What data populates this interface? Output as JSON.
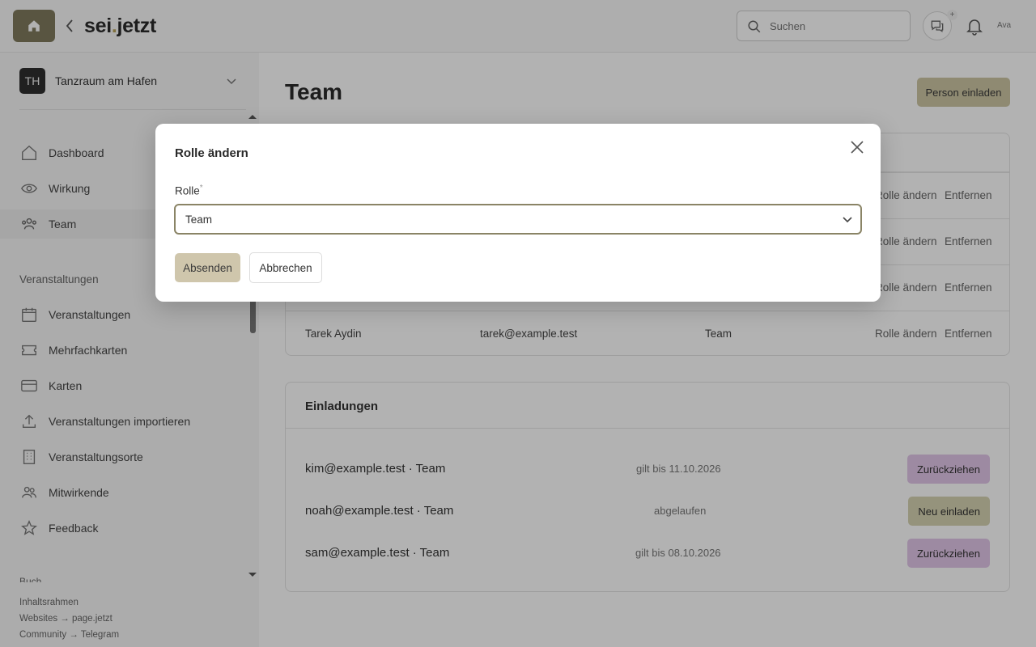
{
  "header": {
    "brand_prefix": "sei",
    "brand_dot": ".",
    "brand_suffix": "jetzt",
    "search_placeholder": "Suchen",
    "chat_plus": "+",
    "avatar_alt": "Ava"
  },
  "sidebar": {
    "org_initials": "TH",
    "org_name": "Tanzraum am Hafen",
    "items": [
      {
        "label": "Dashboard",
        "icon": "home-icon"
      },
      {
        "label": "Wirkung",
        "icon": "eye-icon"
      },
      {
        "label": "Team",
        "icon": "users-icon",
        "active": true
      }
    ],
    "section_events": "Veranstaltungen",
    "event_items": [
      {
        "label": "Veranstaltungen",
        "icon": "calendar-icon"
      },
      {
        "label": "Mehrfachkarten",
        "icon": "ticket-icon"
      },
      {
        "label": "Karten",
        "icon": "card-icon"
      },
      {
        "label": "Veranstaltungen importieren",
        "icon": "upload-icon"
      },
      {
        "label": "Veranstaltungsorte",
        "icon": "building-icon"
      },
      {
        "label": "Mitwirkende",
        "icon": "people-icon"
      },
      {
        "label": "Feedback",
        "icon": "star-icon"
      }
    ],
    "section_partial": "Buch",
    "footer": [
      "Inhaltsrahmen",
      "Websites → page.jetzt",
      "Community → Telegram"
    ]
  },
  "main": {
    "title": "Team",
    "invite_button": "Person einladen",
    "members": [
      {
        "name": "",
        "email": "",
        "role": "",
        "change": "Rolle ändern",
        "remove": "Entfernen"
      },
      {
        "name": "",
        "email": "",
        "role": "",
        "change": "Rolle ändern",
        "remove": "Entfernen"
      },
      {
        "name": "",
        "email": "",
        "role": "",
        "change": "Rolle ändern",
        "remove": "Entfernen"
      },
      {
        "name": "Tarek Aydin",
        "email": "tarek@example.test",
        "role": "Team",
        "change": "Rolle ändern",
        "remove": "Entfernen"
      }
    ],
    "invites_title": "Einladungen",
    "invites": [
      {
        "email": "kim@example.test · Team",
        "status": "gilt bis 11.10.2026",
        "action": "Zurückziehen"
      },
      {
        "email": "noah@example.test · Team",
        "status": "abgelaufen",
        "action": "Neu einladen"
      },
      {
        "email": "sam@example.test · Team",
        "status": "gilt bis 08.10.2026",
        "action": "Zurückziehen"
      }
    ]
  },
  "modal": {
    "title": "Rolle ändern",
    "field_label": "Rolle",
    "required_mark": "*",
    "selected_role": "Team",
    "submit": "Absenden",
    "cancel": "Abbrechen"
  },
  "colors": {
    "accent": "#807a5e",
    "withdraw": "#e1c6e8",
    "reinvite": "#d6d3b2"
  }
}
